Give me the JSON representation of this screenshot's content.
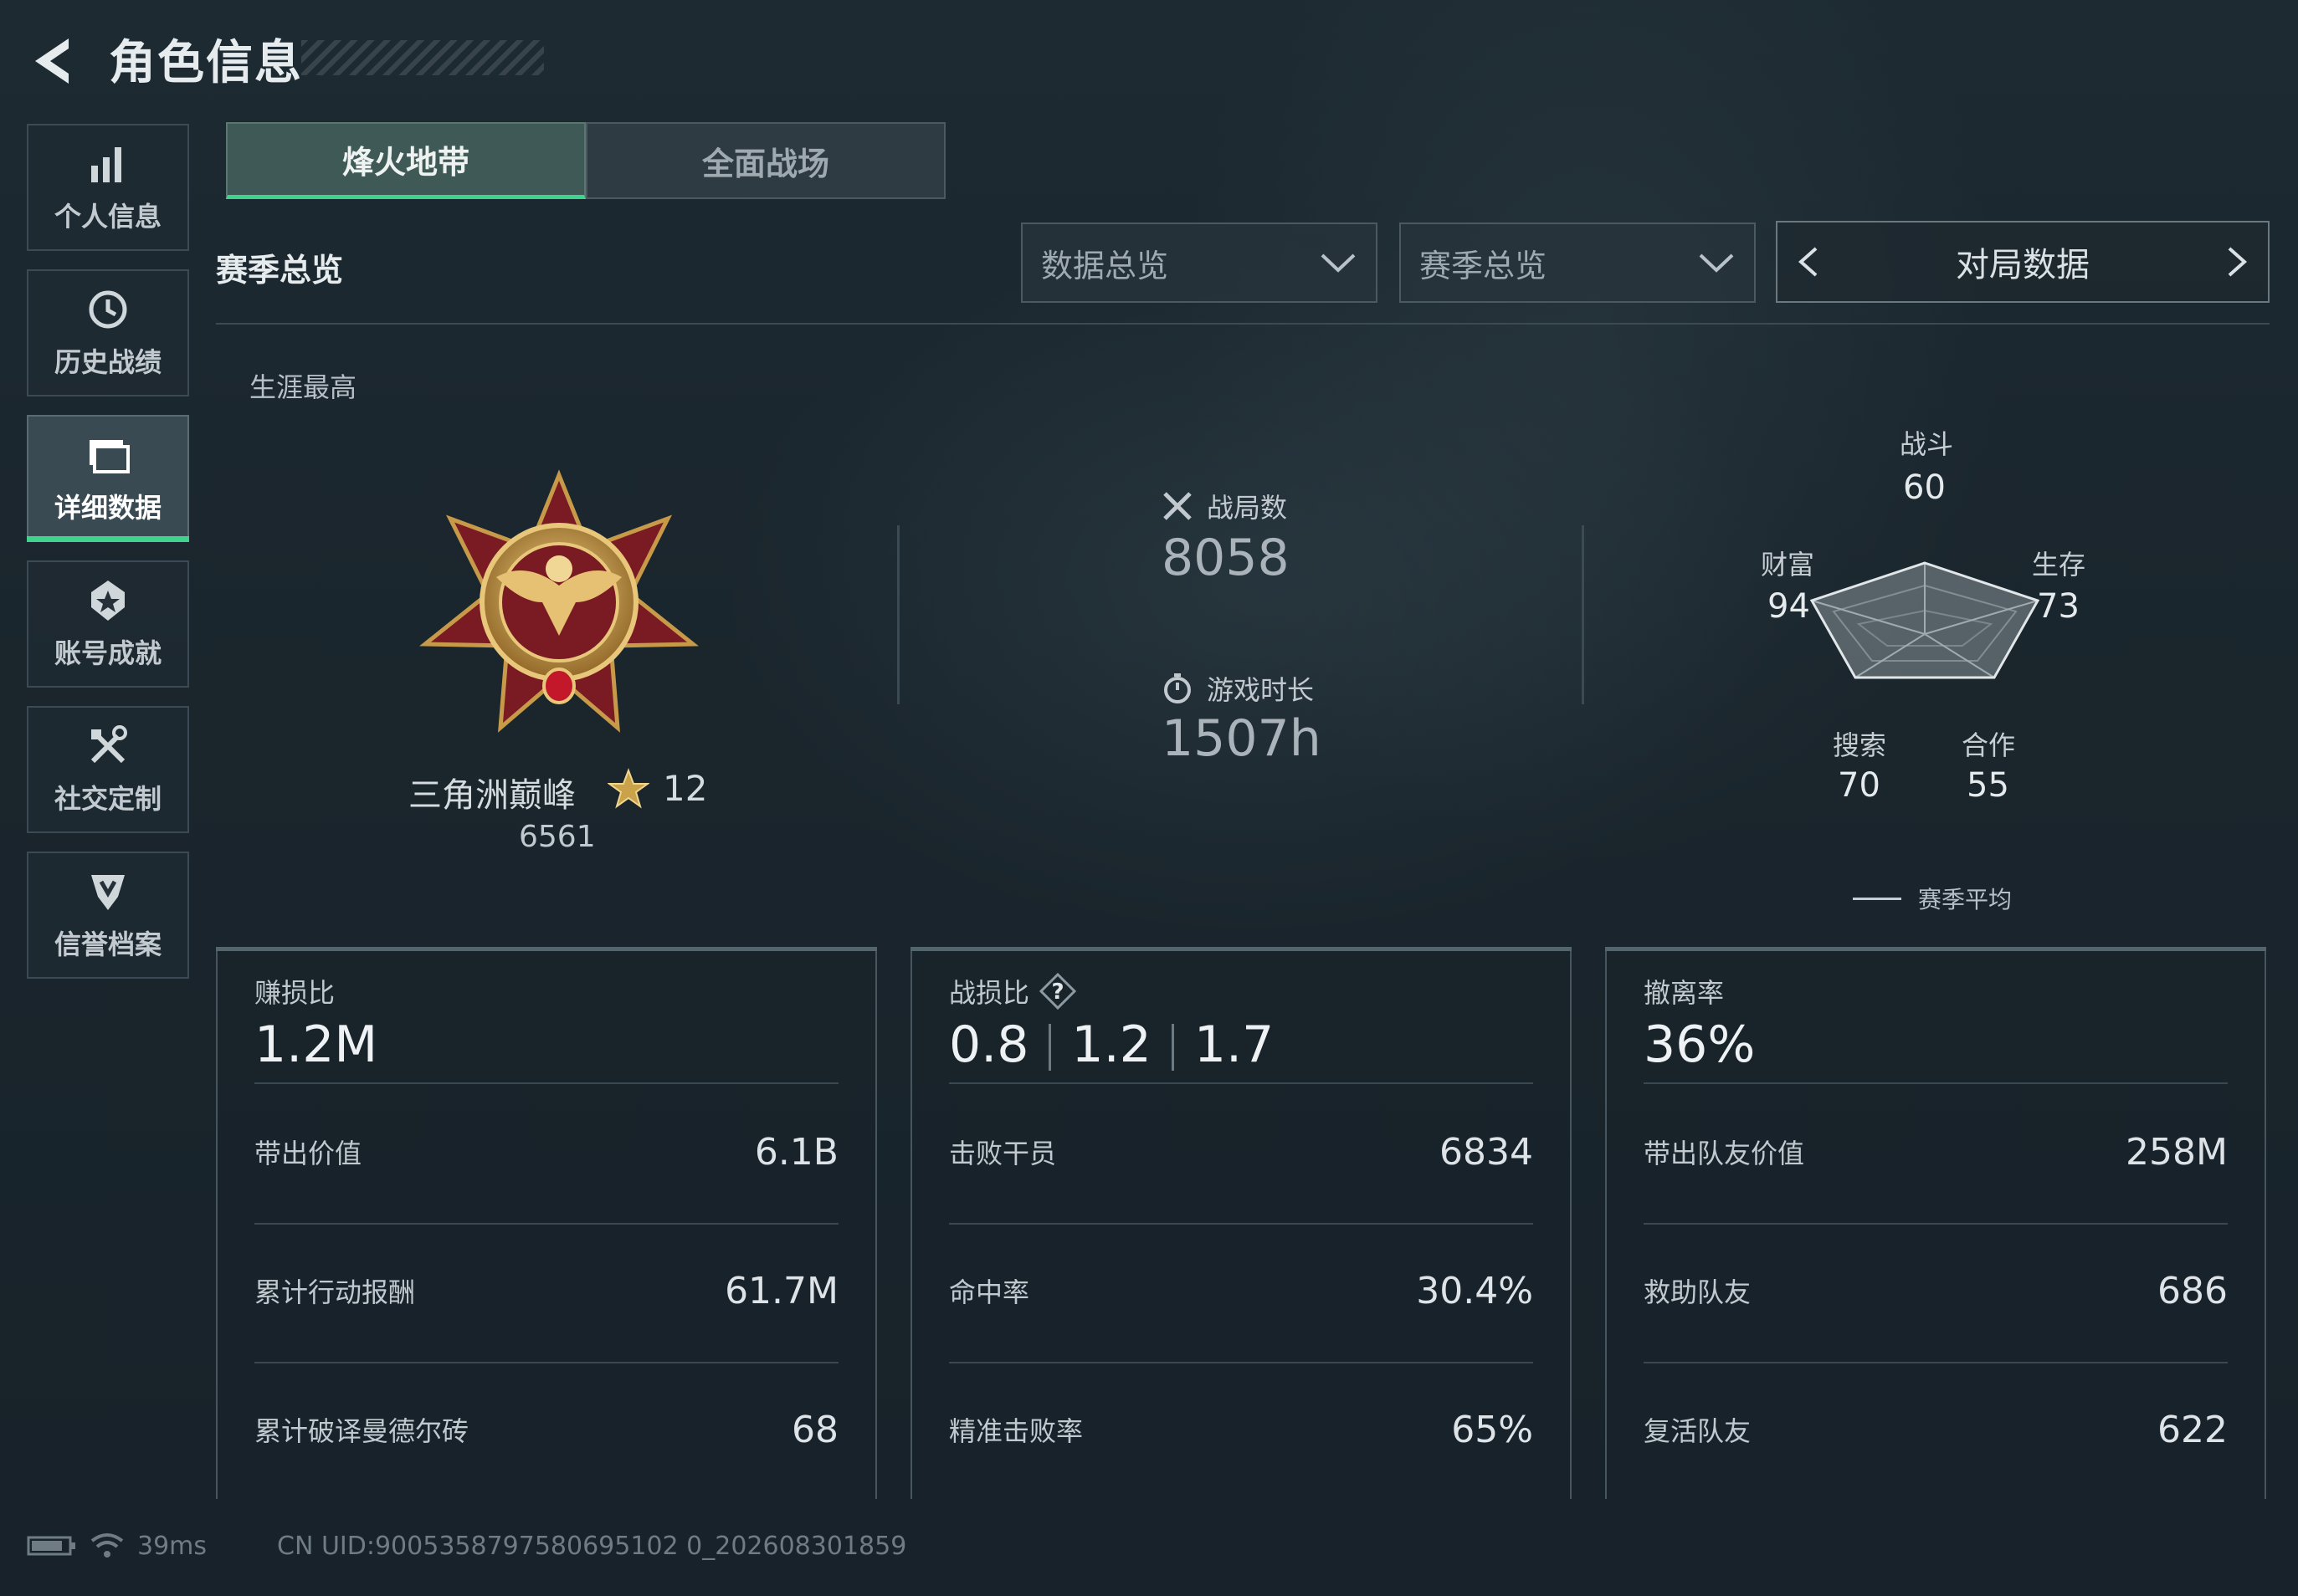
{
  "header": {
    "title": "角色信息"
  },
  "sidebar": {
    "items": [
      {
        "label": "个人信息",
        "icon": "bar-chart-icon",
        "active": false
      },
      {
        "label": "历史战绩",
        "icon": "clock-icon",
        "active": false
      },
      {
        "label": "详细数据",
        "icon": "folder-icon",
        "active": true
      },
      {
        "label": "账号成就",
        "icon": "badge-icon",
        "active": false
      },
      {
        "label": "社交定制",
        "icon": "tools-icon",
        "active": false
      },
      {
        "label": "信誉档案",
        "icon": "shield-icon",
        "active": false
      }
    ]
  },
  "tabs": [
    {
      "label": "烽火地带",
      "active": true
    },
    {
      "label": "全面战场",
      "active": false
    }
  ],
  "section_title": "赛季总览",
  "filters": {
    "data_select": "数据总览",
    "season_select": "赛季总览",
    "pager_label": "对局数据"
  },
  "career": {
    "label": "生涯最高",
    "rank_name": "三角洲巅峰",
    "rank_level": "12",
    "rank_score": "6561"
  },
  "matches": {
    "label": "战局数",
    "value": "8058"
  },
  "playtime": {
    "label": "游戏时长",
    "value": "1507h"
  },
  "radar": {
    "axes": [
      {
        "label": "战斗",
        "value": "60"
      },
      {
        "label": "生存",
        "value": "73"
      },
      {
        "label": "合作",
        "value": "55"
      },
      {
        "label": "搜索",
        "value": "70"
      },
      {
        "label": "财富",
        "value": "94"
      }
    ],
    "legend": "赛季平均"
  },
  "cards": [
    {
      "head_label": "赚损比",
      "head_value": "1.2M",
      "rows": [
        {
          "k": "带出价值",
          "v": "6.1B"
        },
        {
          "k": "累计行动报酬",
          "v": "61.7M"
        },
        {
          "k": "累计破译曼德尔砖",
          "v": "68"
        }
      ]
    },
    {
      "head_label": "战损比",
      "head_values": [
        "0.8",
        "1.2",
        "1.7"
      ],
      "rows": [
        {
          "k": "击败干员",
          "v": "6834"
        },
        {
          "k": "命中率",
          "v": "30.4%"
        },
        {
          "k": "精准击败率",
          "v": "65%"
        }
      ]
    },
    {
      "head_label": "撤离率",
      "head_value": "36%",
      "rows": [
        {
          "k": "带出队友价值",
          "v": "258M"
        },
        {
          "k": "救助队友",
          "v": "686"
        },
        {
          "k": "复活队友",
          "v": "622"
        }
      ]
    }
  ],
  "status": {
    "ping": "39ms",
    "uid": "CN UID:9005358797580695102 0_202608301859"
  },
  "colors": {
    "accent": "#3fd38c"
  }
}
